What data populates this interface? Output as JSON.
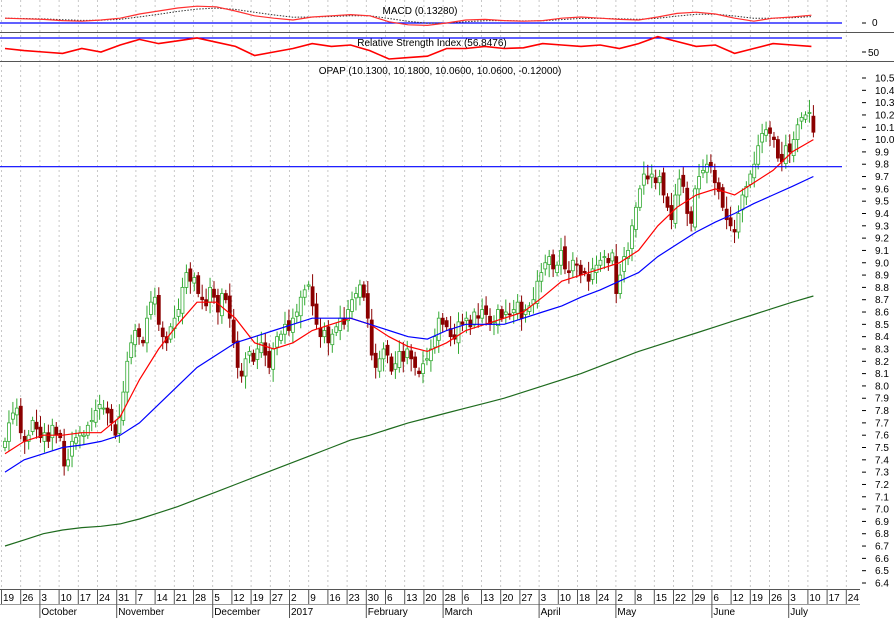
{
  "chart_data": {
    "type": "candlestick",
    "title": "OPAP (10.1300, 10.1800, 10.0600, 10.0600, -0.12000)",
    "ylim": [
      6.4,
      10.5
    ],
    "y_ticks": [
      6.4,
      6.5,
      6.6,
      6.7,
      6.8,
      6.9,
      7.0,
      7.1,
      7.2,
      7.3,
      7.4,
      7.5,
      7.6,
      7.7,
      7.8,
      7.9,
      8.0,
      8.1,
      8.2,
      8.3,
      8.4,
      8.5,
      8.6,
      8.7,
      8.8,
      8.9,
      9.0,
      9.1,
      9.2,
      9.3,
      9.4,
      9.5,
      9.6,
      9.7,
      9.8,
      9.9,
      10.0,
      10.1,
      10.2,
      10.3,
      10.4,
      10.5
    ],
    "x_day_labels": [
      "19",
      "26",
      "3",
      "10",
      "17",
      "24",
      "31",
      "7",
      "14",
      "21",
      "28",
      "5",
      "12",
      "19",
      "27",
      "2",
      "9",
      "16",
      "23",
      "30",
      "6",
      "13",
      "20",
      "28",
      "6",
      "13",
      "20",
      "27",
      "3",
      "10",
      "18",
      "24",
      "2",
      "8",
      "15",
      "22",
      "29",
      "6",
      "12",
      "19",
      "26",
      "3",
      "10",
      "17",
      "24"
    ],
    "x_month_labels": [
      {
        "label": "October",
        "week": 2
      },
      {
        "label": "November",
        "week": 6
      },
      {
        "label": "December",
        "week": 11
      },
      {
        "label": "2017",
        "week": 15
      },
      {
        "label": "February",
        "week": 19
      },
      {
        "label": "March",
        "week": 23
      },
      {
        "label": "April",
        "week": 28
      },
      {
        "label": "May",
        "week": 32
      },
      {
        "label": "June",
        "week": 37
      },
      {
        "label": "July",
        "week": 41
      }
    ],
    "horizontal_line": {
      "value": 9.78,
      "color": "#0000ff"
    },
    "closes": [
      7.55,
      7.7,
      7.78,
      7.82,
      7.62,
      7.55,
      7.6,
      7.72,
      7.65,
      7.58,
      7.62,
      7.55,
      7.68,
      7.6,
      7.58,
      7.35,
      7.4,
      7.55,
      7.58,
      7.62,
      7.6,
      7.68,
      7.72,
      7.8,
      7.85,
      7.82,
      7.78,
      7.7,
      7.6,
      7.75,
      7.95,
      8.2,
      8.35,
      8.45,
      8.4,
      8.35,
      8.55,
      8.68,
      8.72,
      8.5,
      8.4,
      8.35,
      8.48,
      8.55,
      8.62,
      8.8,
      8.92,
      8.85,
      8.88,
      8.75,
      8.7,
      8.65,
      8.8,
      8.72,
      8.6,
      8.75,
      8.7,
      8.55,
      8.35,
      8.15,
      8.08,
      8.22,
      8.28,
      8.2,
      8.3,
      8.35,
      8.25,
      8.15,
      8.3,
      8.4,
      8.42,
      8.5,
      8.45,
      8.55,
      8.6,
      8.72,
      8.78,
      8.82,
      8.65,
      8.5,
      8.4,
      8.45,
      8.35,
      8.42,
      8.48,
      8.55,
      8.5,
      8.62,
      8.7,
      8.75,
      8.82,
      8.72,
      8.55,
      8.25,
      8.15,
      8.22,
      8.3,
      8.25,
      8.12,
      8.18,
      8.28,
      8.2,
      8.3,
      8.22,
      8.15,
      8.1,
      8.18,
      8.22,
      8.3,
      8.4,
      8.55,
      8.5,
      8.48,
      8.4,
      8.38,
      8.52,
      8.5,
      8.55,
      8.48,
      8.6,
      8.55,
      8.62,
      8.58,
      8.5,
      8.52,
      8.62,
      8.55,
      8.6,
      8.58,
      8.62,
      8.68,
      8.55,
      8.62,
      8.65,
      8.7,
      8.85,
      8.92,
      9.0,
      9.05,
      8.95,
      8.98,
      9.1,
      8.95,
      8.92,
      9.02,
      8.98,
      8.9,
      8.92,
      8.85,
      8.95,
      8.98,
      9.02,
      9.05,
      9.0,
      9.08,
      8.75,
      8.9,
      9.05,
      9.1,
      9.3,
      9.45,
      9.6,
      9.72,
      9.68,
      9.72,
      9.65,
      9.7,
      9.55,
      9.45,
      9.35,
      9.55,
      9.68,
      9.62,
      9.4,
      9.32,
      9.6,
      9.7,
      9.75,
      9.8,
      9.78,
      9.65,
      9.58,
      9.45,
      9.35,
      9.3,
      9.25,
      9.4,
      9.55,
      9.62,
      9.72,
      9.8,
      9.95,
      10.05,
      10.08,
      10.05,
      10.0,
      9.85,
      9.82,
      9.95,
      9.9,
      10.0,
      10.12,
      10.18,
      10.2,
      10.22,
      10.06
    ],
    "series": [
      {
        "name": "MA short",
        "color": "#ff0000",
        "weekly_values": [
          7.45,
          7.55,
          7.6,
          7.6,
          7.62,
          7.62,
          7.75,
          8.05,
          8.3,
          8.5,
          8.68,
          8.68,
          8.55,
          8.35,
          8.3,
          8.35,
          8.45,
          8.5,
          8.55,
          8.5,
          8.4,
          8.32,
          8.28,
          8.35,
          8.45,
          8.5,
          8.55,
          8.6,
          8.72,
          8.85,
          8.9,
          8.95,
          9.0,
          9.1,
          9.3,
          9.45,
          9.55,
          9.6,
          9.55,
          9.65,
          9.75,
          9.9,
          10.0
        ]
      },
      {
        "name": "MA medium",
        "color": "#0000ff",
        "weekly_values": [
          7.3,
          7.4,
          7.45,
          7.5,
          7.52,
          7.55,
          7.6,
          7.7,
          7.85,
          8.0,
          8.15,
          8.25,
          8.35,
          8.4,
          8.45,
          8.5,
          8.55,
          8.55,
          8.55,
          8.5,
          8.45,
          8.4,
          8.38,
          8.45,
          8.5,
          8.5,
          8.5,
          8.55,
          8.6,
          8.65,
          8.72,
          8.78,
          8.85,
          8.92,
          9.05,
          9.15,
          9.25,
          9.33,
          9.4,
          9.48,
          9.55,
          9.62,
          9.7
        ]
      },
      {
        "name": "MA long",
        "color": "#1e6b1e",
        "weekly_values": [
          6.7,
          6.75,
          6.8,
          6.83,
          6.85,
          6.86,
          6.88,
          6.92,
          6.97,
          7.02,
          7.08,
          7.14,
          7.2,
          7.26,
          7.32,
          7.38,
          7.44,
          7.5,
          7.56,
          7.6,
          7.65,
          7.7,
          7.74,
          7.78,
          7.82,
          7.86,
          7.9,
          7.95,
          8.0,
          8.05,
          8.1,
          8.16,
          8.22,
          8.28,
          8.33,
          8.38,
          8.43,
          8.48,
          8.53,
          8.58,
          8.63,
          8.68,
          8.73
        ]
      }
    ],
    "colors": {
      "up": "#33aa33",
      "down": "#8b0000",
      "grid": "#bbbbbb"
    }
  },
  "macd": {
    "title": "MACD (0.13280)",
    "axis_label": "0",
    "zero_line_color": "#0000ff",
    "weekly_values": [
      0.08,
      0.07,
      0.06,
      0.04,
      0.03,
      0.05,
      0.08,
      0.15,
      0.2,
      0.25,
      0.28,
      0.27,
      0.2,
      0.12,
      0.08,
      0.05,
      0.1,
      0.12,
      0.14,
      0.12,
      0.02,
      -0.03,
      -0.04,
      0.0,
      0.05,
      0.06,
      0.04,
      0.03,
      0.04,
      0.08,
      0.1,
      0.08,
      0.06,
      0.05,
      0.1,
      0.16,
      0.18,
      0.15,
      0.08,
      0.03,
      0.08,
      0.1,
      0.13
    ]
  },
  "rsi": {
    "title": "Relative Strength Index (56.8476)",
    "axis_label": "50",
    "level": 70,
    "level_color": "#0000ff",
    "weekly_values": [
      55,
      52,
      50,
      48,
      55,
      50,
      60,
      68,
      62,
      66,
      70,
      64,
      58,
      45,
      50,
      55,
      62,
      58,
      60,
      52,
      40,
      42,
      44,
      55,
      55,
      58,
      55,
      56,
      62,
      60,
      58,
      60,
      55,
      62,
      72,
      65,
      58,
      60,
      48,
      55,
      62,
      60,
      58
    ]
  }
}
